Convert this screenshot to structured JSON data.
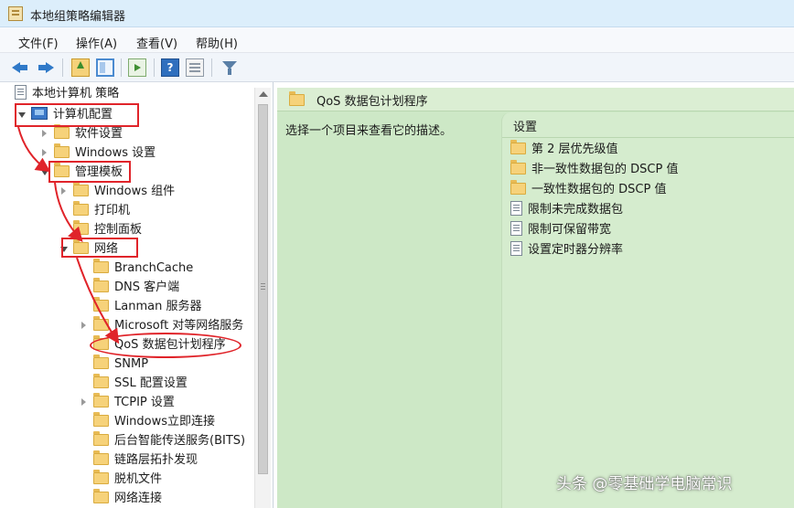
{
  "window": {
    "title": "本地组策略编辑器"
  },
  "menu": [
    "文件(F)",
    "操作(A)",
    "查看(V)",
    "帮助(H)"
  ],
  "tree": {
    "root": "本地计算机 策略",
    "computer_config": "计算机配置",
    "software_settings": "软件设置",
    "windows_settings": "Windows 设置",
    "admin_templates": "管理模板",
    "windows_components": "Windows 组件",
    "printers": "打印机",
    "control_panel": "控制面板",
    "network": "网络",
    "network_children": [
      "BranchCache",
      "DNS 客户端",
      "Lanman 服务器",
      "Microsoft 对等网络服务",
      "QoS 数据包计划程序",
      "SNMP",
      "SSL 配置设置",
      "TCPIP 设置",
      "Windows立即连接",
      "后台智能传送服务(BITS)",
      "链路层拓扑发现",
      "脱机文件",
      "网络连接"
    ]
  },
  "right_pane": {
    "title": "QoS 数据包计划程序",
    "description": "选择一个项目来查看它的描述。",
    "column_header": "设置",
    "items": [
      {
        "label": "第 2 层优先级值",
        "icon": "folder-icon"
      },
      {
        "label": "非一致性数据包的 DSCP 值",
        "icon": "folder-icon"
      },
      {
        "label": "一致性数据包的 DSCP 值",
        "icon": "folder-icon"
      },
      {
        "label": "限制未完成数据包",
        "icon": "policy-setting-icon"
      },
      {
        "label": "限制可保留带宽",
        "icon": "policy-setting-icon"
      },
      {
        "label": "设置定时器分辨率",
        "icon": "policy-setting-icon"
      }
    ]
  },
  "annotation_color": "#e0242a",
  "right_pane_bg": "#cde8c6",
  "watermark": "头条 @零基础学电脑常识"
}
